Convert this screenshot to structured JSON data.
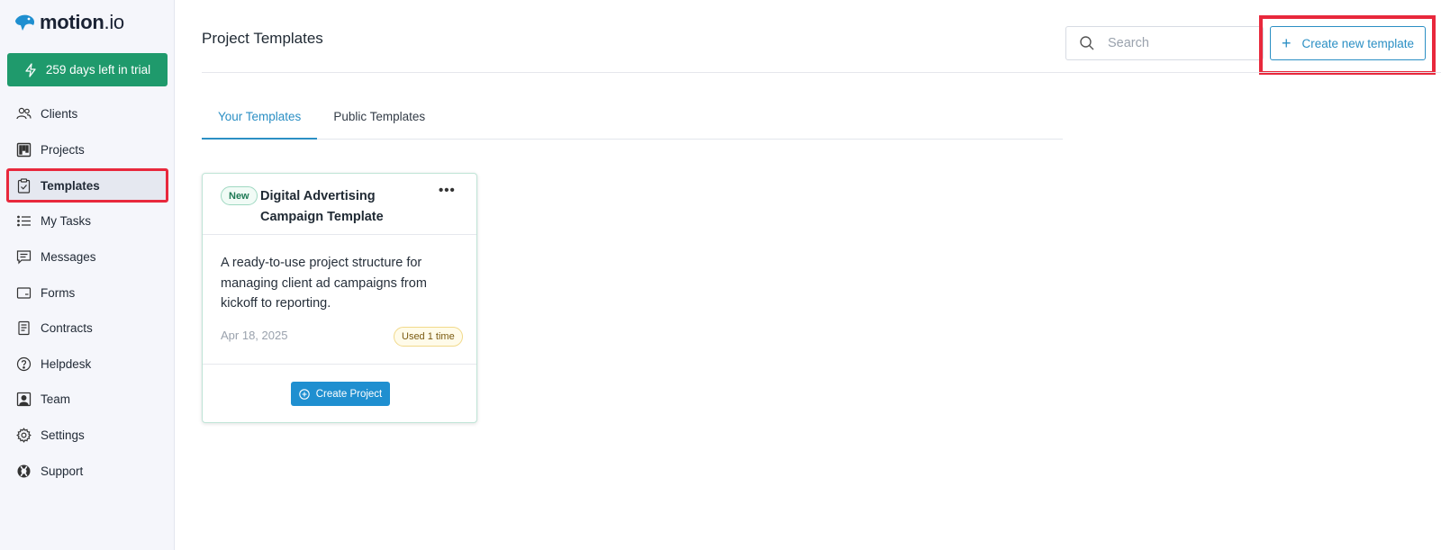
{
  "app": {
    "logo_bold": "motion",
    "logo_light": ".io",
    "trial_label": "259 days left in trial"
  },
  "sidebar": {
    "items": [
      {
        "label": "Clients",
        "icon": "users-icon"
      },
      {
        "label": "Projects",
        "icon": "kanban-icon"
      },
      {
        "label": "Templates",
        "icon": "clipboard-check-icon",
        "active": true
      },
      {
        "label": "My Tasks",
        "icon": "list-icon"
      },
      {
        "label": "Messages",
        "icon": "message-icon"
      },
      {
        "label": "Forms",
        "icon": "form-icon"
      },
      {
        "label": "Contracts",
        "icon": "document-icon"
      },
      {
        "label": "Helpdesk",
        "icon": "help-circle-icon"
      },
      {
        "label": "Team",
        "icon": "team-icon"
      },
      {
        "label": "Settings",
        "icon": "gear-icon"
      },
      {
        "label": "Support",
        "icon": "lifebuoy-icon"
      }
    ]
  },
  "header": {
    "title": "Project Templates",
    "search_placeholder": "Search",
    "create_template_label": "Create new template"
  },
  "tabs": [
    {
      "label": "Your Templates",
      "active": true
    },
    {
      "label": "Public Templates",
      "active": false
    }
  ],
  "templates": [
    {
      "badge": "New",
      "title": "Digital Advertising Campaign Template",
      "description": "A ready-to-use project structure for managing client ad campaigns from kickoff to reporting.",
      "date": "Apr 18, 2025",
      "usage": "Used 1 time",
      "action_label": "Create Project"
    }
  ],
  "colors": {
    "accent": "#2b8fc4",
    "trial_green": "#1f9a6c",
    "highlight_red": "#e8283c",
    "primary_button": "#1f8fd0"
  }
}
